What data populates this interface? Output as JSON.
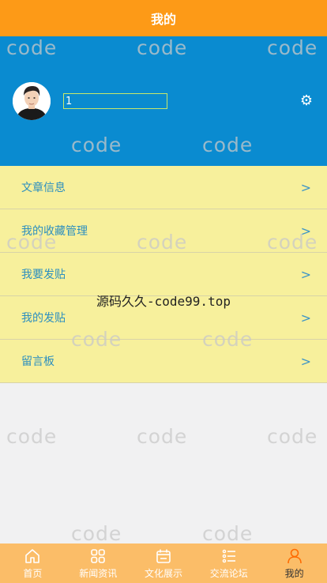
{
  "header": {
    "title": "我的"
  },
  "profile": {
    "name_value": "1"
  },
  "menu": {
    "items": [
      {
        "label": "文章信息"
      },
      {
        "label": "我的收藏管理"
      },
      {
        "label": "我要发贴"
      },
      {
        "label": "我的发贴"
      },
      {
        "label": "留言板"
      }
    ]
  },
  "watermark": {
    "text": "code"
  },
  "center_mark": {
    "text": "源码久久-code99.top"
  },
  "tabbar": {
    "tabs": [
      {
        "label": "首页",
        "icon": "home-icon"
      },
      {
        "label": "新闻资讯",
        "icon": "grid-icon"
      },
      {
        "label": "文化展示",
        "icon": "calendar-icon"
      },
      {
        "label": "交流论坛",
        "icon": "list-icon"
      },
      {
        "label": "我的",
        "icon": "person-icon",
        "active": true
      }
    ]
  },
  "colors": {
    "header_bg": "#fd9a17",
    "profile_bg": "#0a8bd0",
    "menu_bg": "#f7f09c",
    "menu_text": "#2d8fbf",
    "tabbar_bg": "#fbbd68",
    "active_icon": "#ff6a00"
  }
}
